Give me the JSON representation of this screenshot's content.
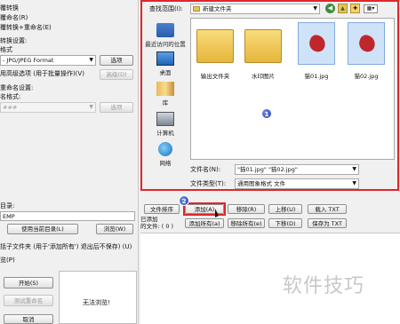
{
  "left_panel": {
    "opt_convert_only": "覆转换",
    "opt_rename_only": "覆命名(R)",
    "opt_convert_rename": "覆转换+重命名(E)",
    "convert_settings_label": "转换设置:",
    "format_label": "格式",
    "format_value": "- JPG/JPEG Format",
    "options_button": "选项",
    "advanced_checkbox_label": "用高级选项 (用于批量操作)(V)",
    "advanced_button": "高级(D)",
    "rename_settings_label": "重命名设置:",
    "name_format_label": "名格式:",
    "name_format_value": "###",
    "rename_options_button": "选项",
    "output_dir_label": "目录:",
    "output_dir_value": "EMP",
    "use_current_dir_button": "使用当前目录(L)",
    "browse_button": "浏览(W)",
    "subfolder_checkbox_label": "括子文件夹 (用于'添加所有') 退出后不保存) (U)",
    "preview_label": "览(P)",
    "start_button": "开始(S)",
    "test_rename_button": "测试重命名",
    "cancel_button": "取消",
    "preview_placeholder": "无法浏览!"
  },
  "dialog": {
    "lookin_label": "查找范围(I):",
    "lookin_value": "新建文件夹",
    "places": [
      {
        "label": "最近访问的位置",
        "icon": "recent-places-icon"
      },
      {
        "label": "桌面",
        "icon": "desktop-icon"
      },
      {
        "label": "库",
        "icon": "library-icon"
      },
      {
        "label": "计算机",
        "icon": "computer-icon"
      },
      {
        "label": "网络",
        "icon": "network-icon"
      }
    ],
    "files": [
      {
        "name": "输出文件夹",
        "type": "folder",
        "selected": false
      },
      {
        "name": "水印图片",
        "type": "folder",
        "selected": false
      },
      {
        "name": "猫01.jpg",
        "type": "image",
        "selected": true
      },
      {
        "name": "猫02.jpg",
        "type": "image",
        "selected": true
      }
    ],
    "filename_label": "文件名(N):",
    "filename_value": "\"猫01.jpg\" \"猫02.jpg\"",
    "filetype_label": "文件类型(T):",
    "filetype_value": "通用图象格式 文件",
    "badge": "1"
  },
  "list_toolbar": {
    "sort_button": "文件排序",
    "add_button": "添加(A)",
    "add_all_button": "添加所有(a)",
    "remove_button": "移除(R)",
    "remove_all_button": "移除所有(e)",
    "up_button": "上移(U)",
    "down_button": "下移(D)",
    "load_txt_button": "载入 TXT",
    "save_txt_button": "保存为 TXT",
    "added_label": "已添加",
    "files_count": "的文件: ( 0 )",
    "badge": "2"
  },
  "watermark_text": "软件技巧",
  "colors": {
    "highlight": "#e0262a",
    "badge": "#1e3ca6"
  }
}
